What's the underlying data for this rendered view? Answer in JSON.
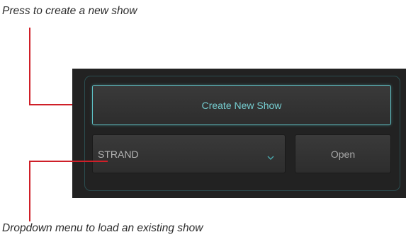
{
  "annotations": {
    "create_caption": "Press to create a new show",
    "dropdown_caption": "Dropdown menu to load an existing show"
  },
  "panel": {
    "create_button_label": "Create New Show",
    "show_select": {
      "selected_value": "STRAND"
    },
    "open_button_label": "Open"
  },
  "colors": {
    "panel_bg": "#222222",
    "accent": "#5ec3c7",
    "callout": "#cf1f28"
  },
  "icons": {
    "dropdown": "chevron-down-icon"
  }
}
